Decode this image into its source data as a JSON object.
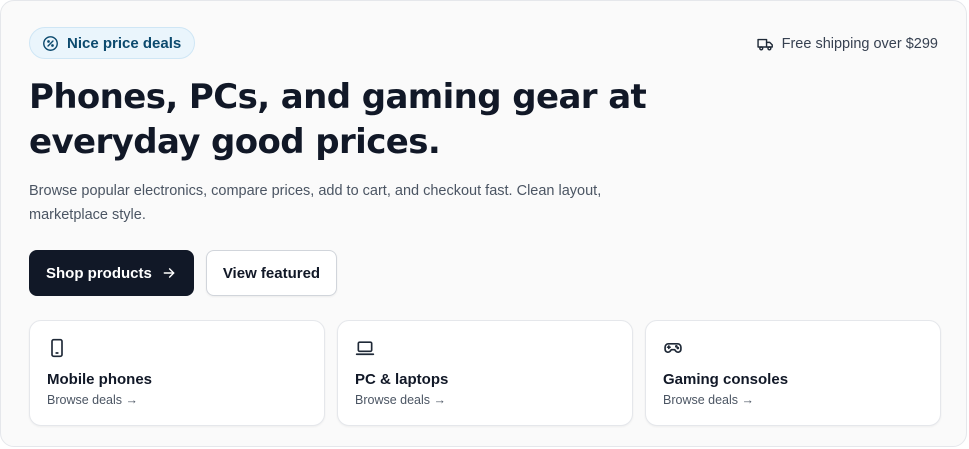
{
  "hero": {
    "badge_label": "Nice price deals",
    "badge_icon": "price-tag-icon",
    "shipping_label": "Free shipping over $299",
    "shipping_icon": "truck-icon",
    "headline": "Phones, PCs, and gaming gear at everyday good prices.",
    "subtext": "Browse popular electronics, compare prices, add to cart, and checkout fast. Clean layout, marketplace style.",
    "primary_button": "Shop products",
    "secondary_button": "View featured"
  },
  "categories": [
    {
      "title": "Mobile phones",
      "link": "Browse deals →",
      "icon": "smartphone-icon"
    },
    {
      "title": "PC & laptops",
      "link": "Browse deals →",
      "icon": "laptop-icon"
    },
    {
      "title": "Gaming consoles",
      "link": "Browse deals →",
      "icon": "gamepad-icon"
    }
  ],
  "colors": {
    "primary": "#111827",
    "badge_bg": "#eaf5fc",
    "badge_text": "#0c4a6e",
    "muted_text": "#4b5563",
    "border": "#e5e7eb"
  }
}
